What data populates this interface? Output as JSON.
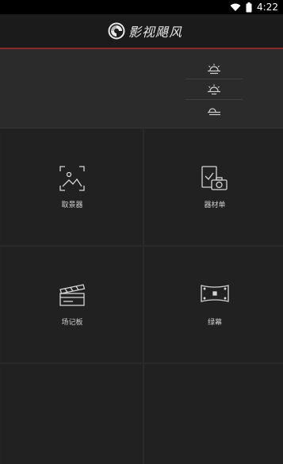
{
  "status_bar": {
    "time": "4:22",
    "icons": [
      "wifi-icon",
      "battery-icon"
    ]
  },
  "header": {
    "logo_text": "影视飓风",
    "logo_icon": "aperture-logo-icon",
    "accent_line_color": "#8b2b2b"
  },
  "panel": {
    "rows": [
      {
        "icon": "sunrise-icon"
      },
      {
        "icon": "sunset-icon"
      },
      {
        "icon": "horizon-icon"
      }
    ]
  },
  "tools": [
    {
      "label": "取景器",
      "icon": "viewfinder-icon"
    },
    {
      "label": "器材单",
      "icon": "equipment-list-icon"
    },
    {
      "label": "场记板",
      "icon": "clapperboard-icon"
    },
    {
      "label": "绿幕",
      "icon": "green-screen-icon"
    }
  ]
}
